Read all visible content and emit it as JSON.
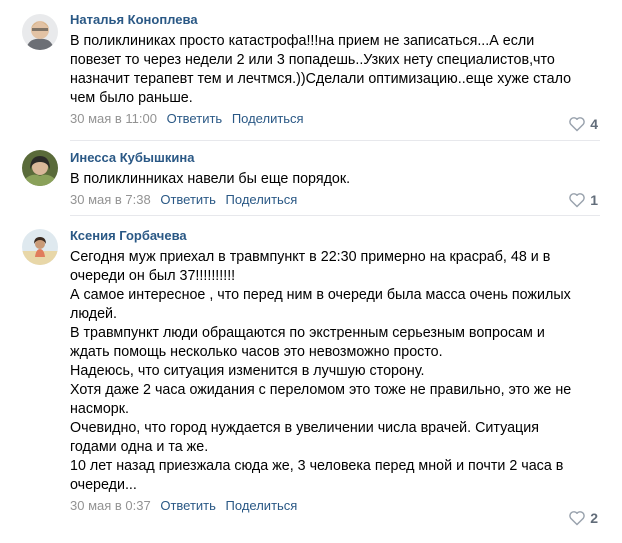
{
  "comments": [
    {
      "author": "Наталья Коноплева",
      "lines": [
        "В поликлиниках просто катастрофа!!!на прием не записаться...А если",
        "повезет то через недели 2 или 3 попадешь..Узких нету специалистов,что",
        "назначит терапевт тем и лечтмся.))Сделали оптимизацию..еще хуже стало",
        "чем было раньше."
      ],
      "date": "30 мая в 11:00",
      "reply": "Ответить",
      "share": "Поделиться",
      "likes": "4"
    },
    {
      "author": "Инесса Кубышкина",
      "lines": [
        "В поликлинниках навели бы еще порядок."
      ],
      "date": "30 мая в 7:38",
      "reply": "Ответить",
      "share": "Поделиться",
      "likes": "1"
    },
    {
      "author": "Ксения Горбачева",
      "lines": [
        "Сегодня муж приехал в травмпункт в 22:30 примерно на красраб, 48 и в",
        "очереди он был 37!!!!!!!!!!",
        "А самое интересное , что перед ним в очереди была масса очень пожилых",
        "людей.",
        "В травмпункт люди обращаются по экстренным серьезным вопросам и",
        "ждать помощь несколько часов это невозможно просто.",
        "Надеюсь, что ситуация изменится в лучшую сторону.",
        "Хотя даже 2 часа ожидания с переломом это тоже не правильно, это же не",
        "насморк.",
        "Очевидно, что город нуждается в увеличении числа врачей. Ситуация",
        "годами одна и та же.",
        "10 лет назад приезжала сюда же, 3 человека перед мной и почти 2 часа в",
        "очереди..."
      ],
      "date": "30 мая в 0:37",
      "reply": "Ответить",
      "share": "Поделиться",
      "likes": "2"
    }
  ],
  "icons": {
    "like": "heart-outline-icon",
    "avatar": "avatar-photo"
  },
  "colors": {
    "link": "#2a5885",
    "meta": "#939393",
    "divider": "#e7e8ec",
    "like": "#626d7a"
  }
}
